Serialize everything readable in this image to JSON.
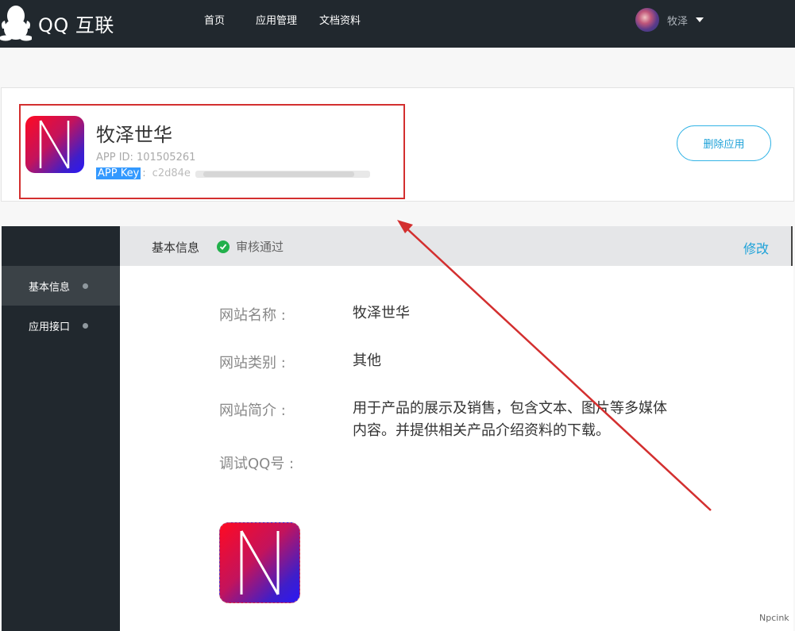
{
  "header": {
    "logo_text": "QQ 互联",
    "nav": [
      "首页",
      "应用管理",
      "文档资料"
    ],
    "user_name": "牧泽"
  },
  "app": {
    "name": "牧泽世华",
    "id_label": "APP ID:",
    "id_value": "101505261",
    "key_label": "APP Key",
    "key_colon": ":",
    "key_value": "c2d84e",
    "delete_label": "删除应用"
  },
  "sidebar": {
    "items": [
      {
        "label": "基本信息",
        "active": true
      },
      {
        "label": "应用接口",
        "active": false
      }
    ]
  },
  "panel": {
    "title": "基本信息",
    "status": "审核通过",
    "edit_label": "修改"
  },
  "fields": [
    {
      "label": "网站名称 :",
      "value": "牧泽世华"
    },
    {
      "label": "网站类别 :",
      "value": "其他"
    },
    {
      "label": "网站简介 :",
      "value": "用于产品的展示及销售，包含文本、图片等多媒体内容。并提供相关产品介绍资料的下载。"
    },
    {
      "label": "调试QQ号 :",
      "value": ""
    }
  ],
  "icon_letter": "N",
  "watermark": "Npcink",
  "colors": {
    "topbar": "#21282e",
    "accent": "#1ca1d8",
    "success": "#22b04b",
    "annotation": "#d32f2f"
  }
}
